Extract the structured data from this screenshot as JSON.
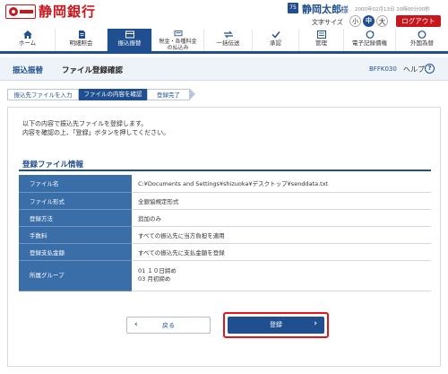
{
  "header": {
    "bank_name": "静岡銀行",
    "user_icon_label": "75",
    "user_name": "静岡太郎",
    "user_suffix": "様",
    "last_login": "2000年02月13日 10時00分00秒",
    "font_size_label": "文字サイズ",
    "font_sizes": [
      "小",
      "中",
      "大"
    ],
    "logout_label": "ログアウト"
  },
  "nav": {
    "items": [
      {
        "label": "ホーム",
        "icon": "home-icon"
      },
      {
        "label": "明細照会",
        "icon": "document-icon"
      },
      {
        "label": "振込振替",
        "icon": "transfer-icon",
        "active": true
      },
      {
        "label": "税金・各種料金の払込み",
        "icon": "payment-icon"
      },
      {
        "label": "一括伝送",
        "icon": "bulk-transfer-icon"
      },
      {
        "label": "承認",
        "icon": "approval-icon"
      },
      {
        "label": "管理",
        "icon": "management-icon"
      },
      {
        "label": "電子記録債権",
        "icon": "electronic-receivable-icon"
      },
      {
        "label": "外国為替",
        "icon": "foreign-exchange-icon"
      }
    ]
  },
  "page": {
    "section": "振込振替",
    "title": "ファイル登録確認",
    "screen_code": "BFFK030",
    "help_label": "ヘルプ",
    "help_icon": "?"
  },
  "steps": [
    {
      "label": "振込先ファイルを入力",
      "state": "done"
    },
    {
      "label": "ファイルの内容を確認",
      "state": "current"
    },
    {
      "label": "登録完了",
      "state": "todo"
    }
  ],
  "intro": {
    "line1": "以下の内容で振込先ファイルを登録します。",
    "line2": "内容を確認の上、「登録」ボタンを押してください。"
  },
  "info": {
    "heading": "登録ファイル情報",
    "rows": [
      {
        "label": "ファイル名",
        "value": "C:¥Documents and Settings¥shizuoka¥デスクトップ¥senddata.txt"
      },
      {
        "label": "ファイル形式",
        "value": "全銀協規定形式"
      },
      {
        "label": "登録方法",
        "value": "追加のみ"
      },
      {
        "label": "手数料",
        "value": "すべての振込先に当方負担を適用"
      },
      {
        "label": "登録支払金額",
        "value": "すべての振込先に支払金額を登録"
      },
      {
        "label": "所属グループ",
        "value_line1": "01 １０日締め",
        "value_line2": "03 月初締め"
      }
    ]
  },
  "buttons": {
    "back_label": "戻る",
    "register_label": "登録"
  },
  "colors": {
    "brand_red": "#c8161d",
    "primary_blue": "#1f4f8f",
    "table_header_blue": "#3a6ea8",
    "highlight_red": "#e0151d"
  }
}
